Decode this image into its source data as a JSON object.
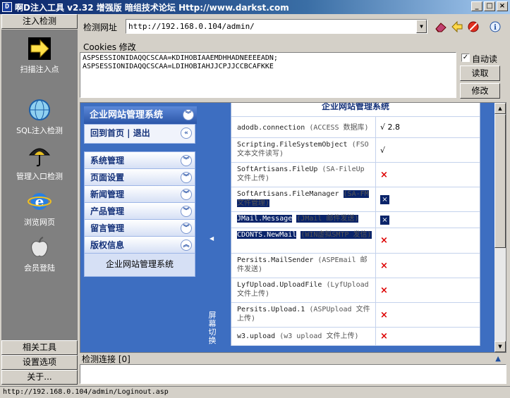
{
  "window": {
    "title": "啊D注入工具 v2.32 增强版 暗组技术论坛 Http://www.darkst.com",
    "app_icon": "D"
  },
  "sidebar": {
    "header": "注入检测",
    "items": [
      {
        "label": "扫描注入点",
        "icon": "arrow-right-icon"
      },
      {
        "label": "SQL注入检测",
        "icon": "globe-icon"
      },
      {
        "label": "管理入口检测",
        "icon": "umbrella-icon"
      },
      {
        "label": "浏览网页",
        "icon": "ie-icon"
      },
      {
        "label": "会员登陆",
        "icon": "apple-icon"
      }
    ],
    "footer": [
      "相关工具",
      "设置选项",
      "关于..."
    ]
  },
  "toolbar": {
    "url_label": "检测网址",
    "url_value": "http://192.168.0.104/admin/"
  },
  "cookies": {
    "label": "Cookies 修改",
    "value_lines": [
      "ASPSESSIONIDAQQCSCAA=KDIHOBIAAEMDHHADNEEEEADN;",
      "ASPSESSIONIDAQQCSCAA=LDIHOBIAHJJCPJJCCBCAFKKE"
    ],
    "auto_read_label": "自动读",
    "auto_read_checked": true,
    "read_button": "读取",
    "modify_button": "修改"
  },
  "site": {
    "menu_title": "企业网站管理系统",
    "home_links": "回到首页 | 退出",
    "menus": [
      "系统管理",
      "页面设置",
      "新闻管理",
      "产品管理",
      "留言管理",
      "版权信息"
    ],
    "copyright_sub": "企业网站管理系统",
    "splitter_label": "屏幕切换",
    "content_title": "企业网站管理系统",
    "rows": [
      {
        "name": "adodb.connection",
        "note": "(ACCESS 数据库)",
        "status": "√ 2.8",
        "kind": "ok"
      },
      {
        "name": "Scripting.FileSystemObject",
        "note": "(FSO 文本文件读写)",
        "status": "√",
        "kind": "ok"
      },
      {
        "name": "SoftArtisans.FileUp",
        "note": "(SA-FileUp 文件上传)",
        "status": "×",
        "kind": "x"
      },
      {
        "name": "SoftArtisans.FileManager",
        "note": "(SA-FM 文件管理)",
        "status": "×",
        "kind": "xbox"
      },
      {
        "name": "JMail.Message",
        "note": "(JMail 邮件发送)",
        "status": "×",
        "kind": "xbox"
      },
      {
        "name": "CDONTS.NewMail",
        "note": "(WIN虚拟SMTP 发信)",
        "status": "×",
        "kind": "x"
      },
      {
        "name": "Persits.MailSender",
        "note": "(ASPEmail 邮件发送)",
        "status": "×",
        "kind": "x"
      },
      {
        "name": "LyfUpload.UploadFile",
        "note": "(LyfUpload 文件上传)",
        "status": "×",
        "kind": "x"
      },
      {
        "name": "Persits.Upload.1",
        "note": "(ASPUpload 文件上传)",
        "status": "×",
        "kind": "x"
      },
      {
        "name": "w3.upload",
        "note": "(w3 upload 文件上传)",
        "status": "×",
        "kind": "x"
      }
    ]
  },
  "log": {
    "label": "检测连接 [0]"
  },
  "status": {
    "text": "http://192.168.0.104/admin/Loginout.asp"
  }
}
